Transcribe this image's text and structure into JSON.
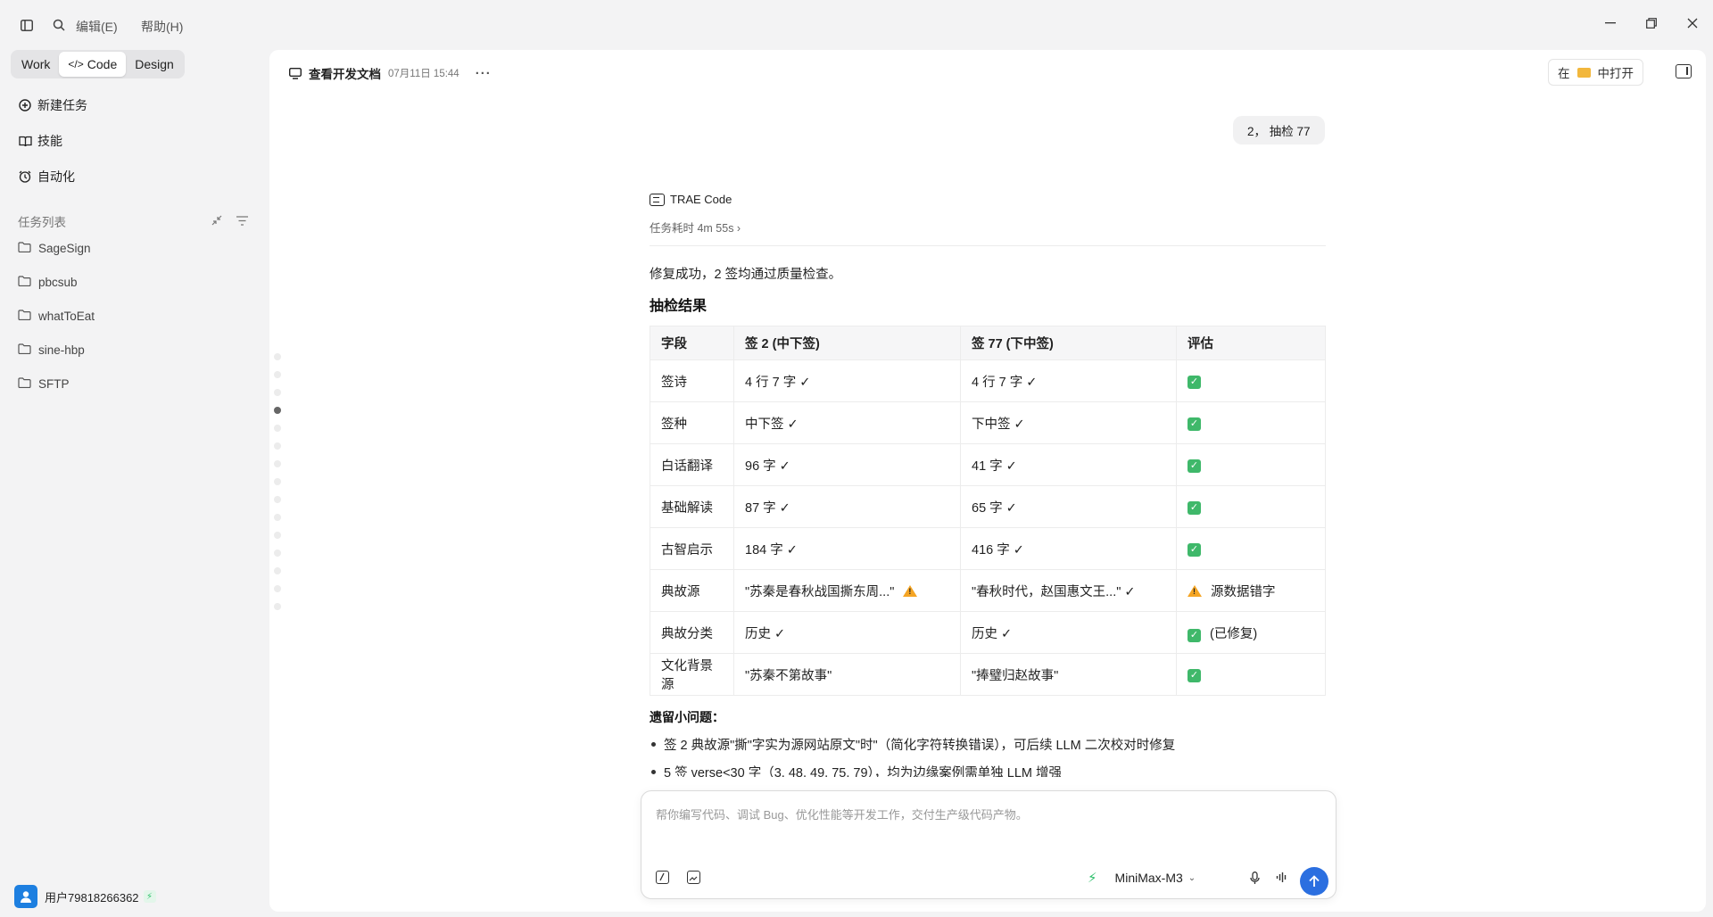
{
  "titlebar": {
    "menu": [
      "编辑(E)",
      "帮助(H)"
    ]
  },
  "mode_tabs": [
    {
      "label": "Work",
      "active": false
    },
    {
      "label": "Code",
      "active": true
    },
    {
      "label": "Design",
      "active": false
    }
  ],
  "nav": {
    "new_task": "新建任务",
    "skills": "技能",
    "automation": "自动化"
  },
  "task_list": {
    "label": "任务列表",
    "folders": [
      "SageSign",
      "pbcsub",
      "whatToEat",
      "sine-hbp",
      "SFTP"
    ]
  },
  "user": {
    "name": "用户79818266362"
  },
  "header": {
    "title": "查看开发文档",
    "date": "07月11日 15:44",
    "open_prefix": "在",
    "open_suffix": "中打开"
  },
  "chat": {
    "user_message": "2， 抽检 77",
    "agent_name": "TRAE Code",
    "duration": "任务耗时 4m 55s ›",
    "result_text": "修复成功，2 签均通过质量检查。",
    "section_title": "抽检结果",
    "table": {
      "headers": [
        "字段",
        "签 2 (中下签)",
        "签 77 (下中签)",
        "评估"
      ],
      "rows": [
        {
          "field": "签诗",
          "c2": "4 行 7 字 ✓",
          "c77": "4 行 7 字 ✓",
          "eval": ""
        },
        {
          "field": "签种",
          "c2": "中下签 ✓",
          "c77": "下中签 ✓",
          "eval": ""
        },
        {
          "field": "白话翻译",
          "c2": "96 字 ✓",
          "c77": "41 字 ✓",
          "eval": ""
        },
        {
          "field": "基础解读",
          "c2": "87 字 ✓",
          "c77": "65 字 ✓",
          "eval": ""
        },
        {
          "field": "古智启示",
          "c2": "184 字 ✓",
          "c77": "416 字 ✓",
          "eval": ""
        },
        {
          "field": "典故源",
          "c2": "\"苏秦是春秋战国撕东周...\"",
          "c77": "\"春秋时代，赵国惠文王...\" ✓",
          "eval": "源数据错字"
        },
        {
          "field": "典故分类",
          "c2": "历史 ✓",
          "c77": "历史 ✓",
          "eval": "(已修复)"
        },
        {
          "field": "文化背景源",
          "c2": "\"苏秦不第故事\"",
          "c77": "\"捧璧归赵故事\"",
          "eval": ""
        }
      ]
    },
    "issues_title": "遗留小问题：",
    "issues": [
      "签 2 典故源\"撕\"字实为源网站原文\"时\"（简化字符转换错误），可后续 LLM 二次校对时修复",
      "5 签 verse<30 字（3, 48, 49, 75, 79），均为边缘案例需单独 LLM 增强"
    ]
  },
  "composer": {
    "placeholder": "帮你编写代码、调试 Bug、优化性能等开发工作，交付生产级代码产物。",
    "model": "MiniMax-M3"
  },
  "colors": {
    "accent": "#2b6fe0",
    "check": "#3fb86a",
    "warning": "#f5a524",
    "bolt": "#2cbf6a"
  }
}
